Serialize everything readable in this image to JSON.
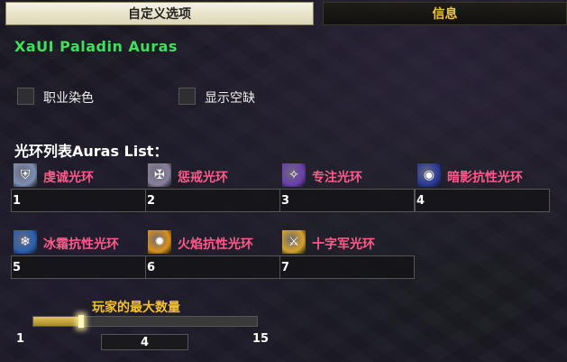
{
  "tabs": [
    {
      "label": "自定义选项",
      "active": true
    },
    {
      "label": "信息",
      "active": false
    }
  ],
  "title": "XaUI Paladin Auras",
  "options": [
    {
      "label": "职业染色",
      "checked": false
    },
    {
      "label": "显示空缺",
      "checked": false
    }
  ],
  "list_header": "光环列表Auras List：",
  "auras": [
    {
      "name": "虔诚光环",
      "slot": "1",
      "icon": "devotion-aura-icon",
      "color": "#7c8fb5"
    },
    {
      "name": "惩戒光环",
      "slot": "2",
      "icon": "retribution-aura-icon",
      "color": "#8a7fa0"
    },
    {
      "name": "专注光环",
      "slot": "3",
      "icon": "concentration-aura-icon",
      "color": "#6a3fb0"
    },
    {
      "name": "暗影抗性光环",
      "slot": "4",
      "icon": "shadow-resistance-aura-icon",
      "color": "#283a9a"
    },
    {
      "name": "冰霜抗性光环",
      "slot": "5",
      "icon": "frost-resistance-aura-icon",
      "color": "#2a5fb0"
    },
    {
      "name": "火焰抗性光环",
      "slot": "6",
      "icon": "fire-resistance-aura-icon",
      "color": "#d9901c"
    },
    {
      "name": "十字军光环",
      "slot": "7",
      "icon": "crusader-aura-icon",
      "color": "#d4a12a"
    }
  ],
  "slider": {
    "label": "玩家的最大数量",
    "min": "1",
    "max": "15",
    "value": "4",
    "fraction": 0.2143
  }
}
